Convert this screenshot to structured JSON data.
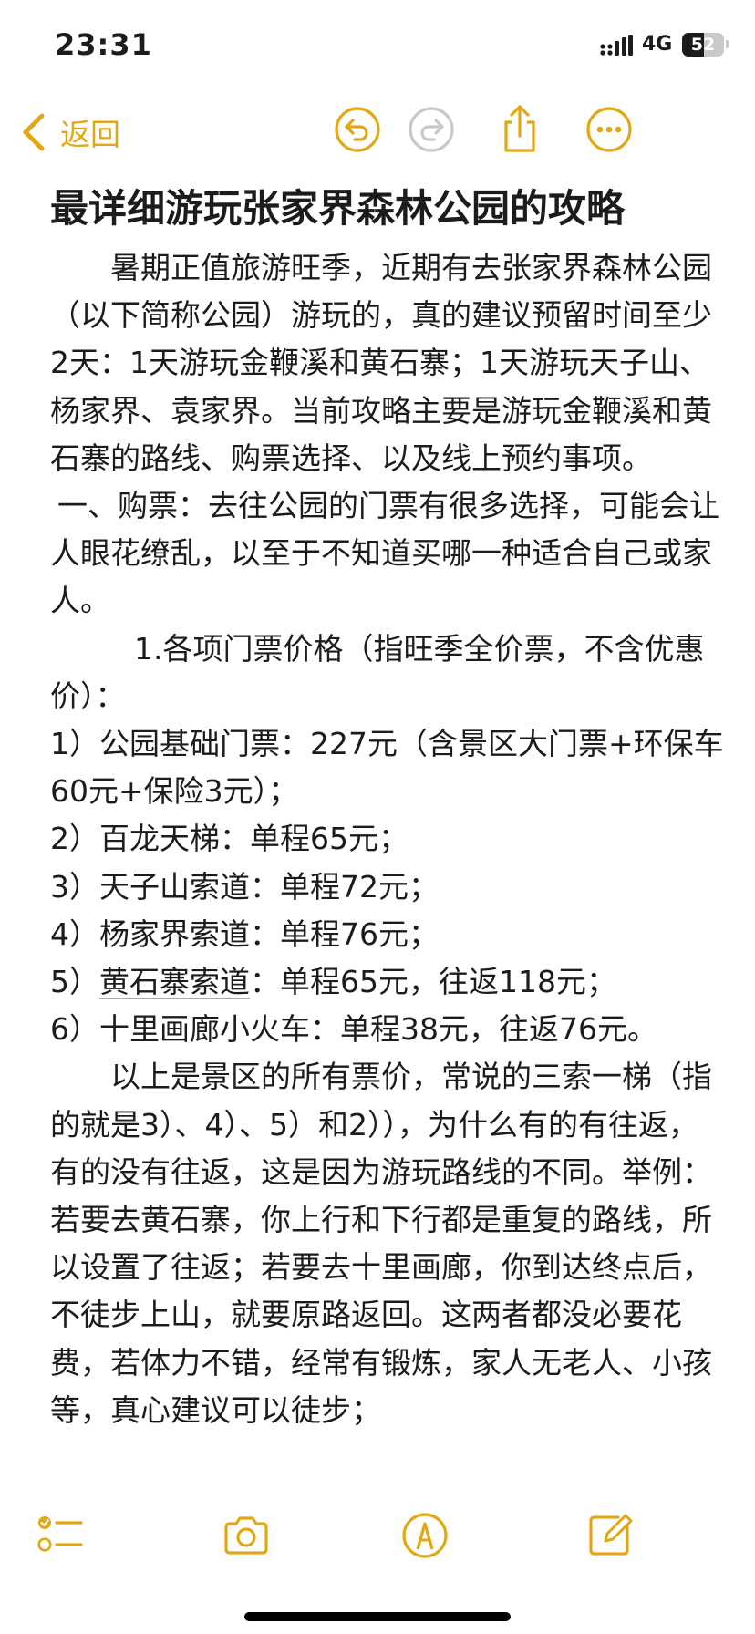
{
  "status_bar": {
    "time": "23:31",
    "network": "4G",
    "battery_percent": "52",
    "battery_level": 0.52
  },
  "nav": {
    "back_label": "返回",
    "accent_color": "#e2a814",
    "disabled_color": "#c7c7cc"
  },
  "note": {
    "title": "最详细游玩张家界森林公园的攻略",
    "paragraphs": [
      "暑期正值旅游旺季，近期有去张家界森林公园（以下简称公园）游玩的，真的建议预留时间至少2天：1天游玩金鞭溪和黄石寨；1天游玩天子山、杨家界、袁家界。当前攻略主要是游玩金鞭溪和黄石寨的路线、购票选择、以及线上预约事项。",
      "一、购票：去往公园的门票有很多选择，可能会让人眼花缭乱，以至于不知道买哪一种适合自己或家人。",
      "1.各项门票价格（指旺季全价票，不含优惠价）：",
      "1）公园基础门票：227元（含景区大门票+环保车60元+保险3元）；",
      "2）百龙天梯：单程65元；",
      "3）天子山索道：单程72元；",
      "4）杨家界索道：单程76元；",
      "：单程65元，往返118元；",
      "6）十里画廊小火车：单程38元，往返76元。",
      "以上是景区的所有票价，常说的三索一梯（指的就是3）、4）、5）和2）），为什么有的有往返，有的没有往返，这是因为游玩路线的不同。举例：若要去黄石寨，你上行和下行都是重复的路线，所以设置了往返；若要去十里画廊，你到达终点后，不徒步上山，就要原路返回。这两者都没必要花费，若体力不错，经常有锻炼，家人无老人、小孩等，真心建议可以徒步；"
    ],
    "item5_prefix": "5）",
    "item5_link": "黄石寨索道"
  },
  "toolbar": {
    "icons": [
      "checklist-icon",
      "camera-icon",
      "markup-icon",
      "compose-icon"
    ]
  }
}
